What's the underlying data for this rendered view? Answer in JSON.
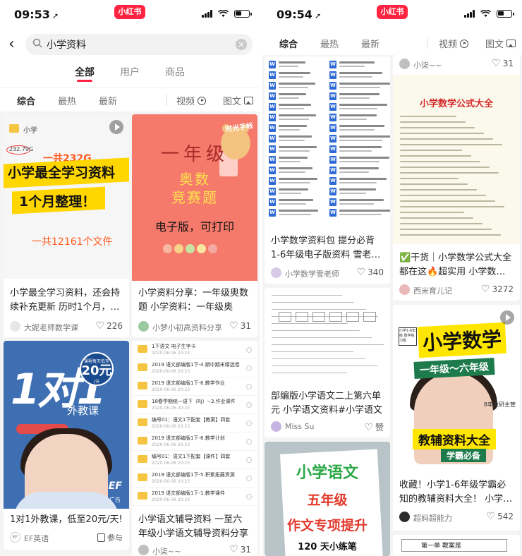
{
  "left": {
    "status": {
      "time": "09:53",
      "logo": "小红书"
    },
    "search": {
      "query": "小学资料"
    },
    "scope_tabs": [
      {
        "label": "全部",
        "active": true
      },
      {
        "label": "用户",
        "active": false
      },
      {
        "label": "商品",
        "active": false
      }
    ],
    "sort": {
      "tabs": [
        "综合",
        "最热",
        "最新"
      ],
      "video": "视频",
      "image": "图文"
    },
    "cards": {
      "c1": {
        "title": "小学最全学习资料，还会持续补充更新 历时1个月，…",
        "author": "大妮老师数学课",
        "likes": "226",
        "overlay": {
          "header": "小学",
          "size": "232.79G",
          "total_size": "一共232G",
          "line1": "小学最全学习资料",
          "line2": "1个月整理！",
          "file_count": "一共12161个文件"
        }
      },
      "c2": {
        "title": "小学资料分享：一年级奥数题 小学资料：一年级奥数…",
        "author": "小梦小初高资料分享",
        "likes": "31",
        "overlay": {
          "slogan": "时光手帐",
          "t1": "一年级",
          "t2": "奥数",
          "t3": "竞赛题",
          "t4": "电子版，可打印"
        }
      },
      "c3": {
        "title": "1对1外教课，低至20元/天!",
        "author": "EF英语",
        "action": "参与",
        "overlay": {
          "big": "1对1",
          "badge_top": "课程每天低至",
          "badge_price": "20元",
          "badge_unit": "/节",
          "sub": "外教课",
          "logo": "EF",
          "ad": "广告"
        }
      },
      "c4": {
        "title": "小学语文辅导资料 一至六年级小学语文辅导资料分享",
        "author": "小柒~~",
        "likes": "31",
        "files": [
          {
            "name": "1下语文 电子生字卡",
            "date": "2020-06-06 20:23"
          },
          {
            "name": "2019 语文部编版1下-4.期中期末精选卷",
            "date": "2020-06-06 20:23"
          },
          {
            "name": "2019 语文部编版1下-6.教学作业",
            "date": "2020-06-06 20:23"
          },
          {
            "name": "18春学期统一语下（RJ）--3.作业课件",
            "date": "2020-06-06 20:23"
          },
          {
            "name": "编号01：语文1下配套【教案】四套",
            "date": "2020-06-06 20:23"
          },
          {
            "name": "2019 语文部编版1下-6.教学计划",
            "date": "2020-06-06 20:23"
          },
          {
            "name": "编号01：语文1下配套【课件】四套",
            "date": "2020-06-06 20:23"
          },
          {
            "name": "2019 语文部编版1下-5.积累拓展资源",
            "date": "2020-06-06 20:23"
          },
          {
            "name": "2019 语文部编版1下-1.教学课件",
            "date": "2020-06-06 20:23"
          },
          {
            "name": "1下语文学案 两套",
            "date": "2020-06-06 20:23"
          }
        ]
      }
    }
  },
  "right": {
    "status": {
      "time": "09:54",
      "logo": "小红书"
    },
    "sort": {
      "tabs": [
        "综合",
        "最热",
        "最新"
      ],
      "video": "视频",
      "image": "图文"
    },
    "cards": {
      "r1": {
        "title": "小学数学资料包 提分必背 1-6年级电子版资料 雪老…",
        "author": "小学数学雪老师",
        "likes": "340"
      },
      "r2": {
        "top_author": "小柒~~",
        "top_likes": "31",
        "poster_title": "小学数学公式大全",
        "title": "✅干货｜小学数学公式大全都在这🔥超实用 小学数…",
        "author": "西米育儿记",
        "likes": "3272"
      },
      "r3": {
        "title": "部编版小学语文二上第六单元 小学语文资料#小学语文",
        "author": "Miss Su",
        "likes": "赞"
      },
      "r4": {
        "title": "收藏！小学1-6年级学霸必知的教辅资料大全！ 小学…",
        "author": "超妈超能力",
        "likes": "542",
        "overlay": {
          "note": "小学1-6年级 数学练习题",
          "math": "小学数学",
          "grade": "一年级～六年级",
          "teacher": "8年教研主管",
          "t3": "教辅资料大全",
          "t4": "学霸必备"
        }
      },
      "r5": {
        "t1": "小学语文",
        "t2": "五年级",
        "t3": "作文专项提升",
        "t4": "120 天小练笔"
      },
      "r6": {
        "text": "第一单 教案是"
      }
    }
  },
  "colors": {
    "brand": "#ff2442",
    "highlight": "#ffd600",
    "orange": "#ff5a1f"
  }
}
